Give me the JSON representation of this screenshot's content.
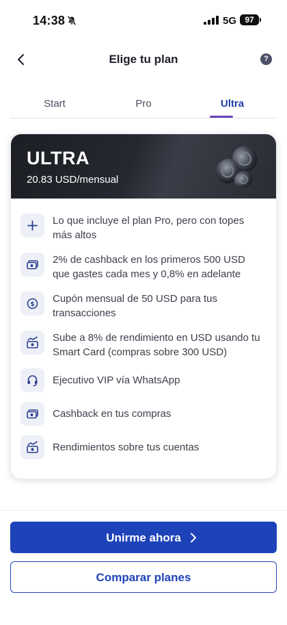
{
  "status_bar": {
    "time": "14:38",
    "network": "5G",
    "battery": "97"
  },
  "header": {
    "title": "Elige tu plan",
    "help_icon": "?"
  },
  "tabs": [
    {
      "label": "Start",
      "active": false
    },
    {
      "label": "Pro",
      "active": false
    },
    {
      "label": "Ultra",
      "active": true
    }
  ],
  "plan": {
    "name": "ULTRA",
    "price": "20.83 USD/mensual",
    "benefits": [
      {
        "icon": "plus-icon",
        "text": "Lo que incluye el plan Pro, pero con topes más altos"
      },
      {
        "icon": "cash-icon",
        "text": "2% de cashback en los primeros 500 USD que gastes cada mes y 0,8% en adelante"
      },
      {
        "icon": "coupon-icon",
        "text": "Cupón mensual de 50 USD para tus transacciones"
      },
      {
        "icon": "growth-icon",
        "text": "Sube a 8% de rendimiento en USD usando tu Smart Card (compras sobre 300 USD)"
      },
      {
        "icon": "headset-icon",
        "text": "Ejecutivo VIP vía WhatsApp"
      },
      {
        "icon": "cash-icon",
        "text": "Cashback en tus compras"
      },
      {
        "icon": "growth-icon",
        "text": "Rendimientos sobre tus cuentas"
      }
    ]
  },
  "actions": {
    "join_label": "Unirme ahora",
    "compare_label": "Comparar planes"
  },
  "colors": {
    "primary": "#1e43b8",
    "tab_indicator": "#6b3fb8",
    "banner": "#1c1e24"
  }
}
